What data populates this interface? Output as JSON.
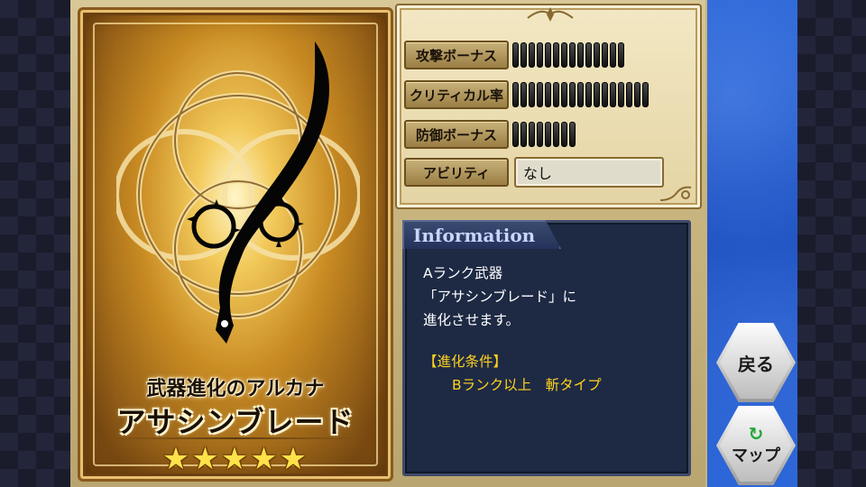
{
  "card": {
    "subtitle": "武器進化のアルカナ",
    "name": "アサシンブレード",
    "stars": "★★★★★",
    "rarity": 5
  },
  "stats": {
    "attack_label": "攻撃ボーナス",
    "attack_level": 14,
    "critical_label": "クリティカル率",
    "critical_level": 17,
    "defense_label": "防御ボーナス",
    "defense_level": 8,
    "ability_label": "アビリティ",
    "ability_value": "なし"
  },
  "info": {
    "title": "Information",
    "line1": "Aランク武器",
    "line2": "「アサシンブレード」に",
    "line3": "進化させます。",
    "cond_title": "【進化条件】",
    "cond_value": "Bランク以上　斬タイプ"
  },
  "nav": {
    "back_label": "戻る",
    "map_label": "マップ",
    "map_icon": "refresh-arrow-icon"
  },
  "colors": {
    "accent_gold": "#c88a22",
    "info_bg": "#1e2a44",
    "cond_yellow": "#ffd21e",
    "blue_panel": "#2a64d6"
  }
}
